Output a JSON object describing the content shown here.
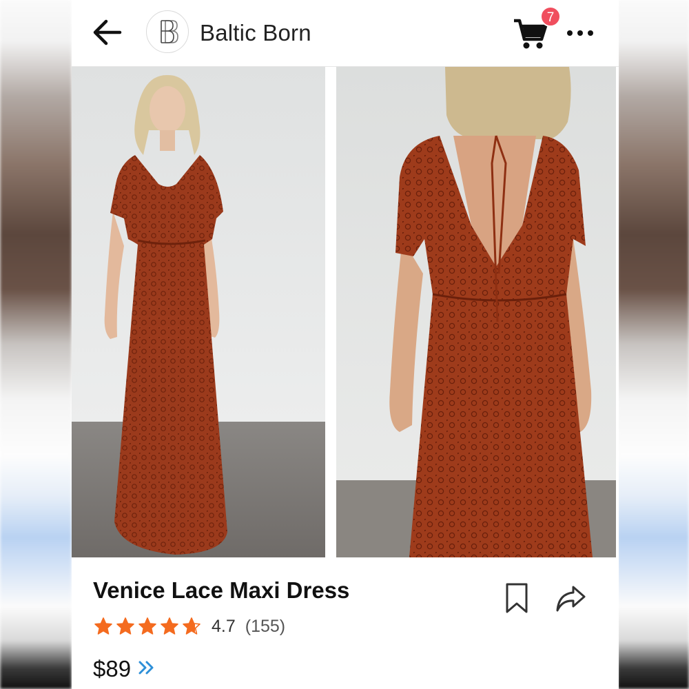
{
  "header": {
    "store_name": "Baltic Born",
    "cart_count": "7"
  },
  "product": {
    "title": "Venice Lace Maxi Dress",
    "rating": "4.7",
    "review_count": "(155)",
    "rating_stars": 4.7,
    "price": "$89"
  },
  "icons": {
    "back": "arrow-left-icon",
    "cart": "shopping-cart-icon",
    "more": "more-horizontal-icon",
    "bookmark": "bookmark-icon",
    "share": "share-icon",
    "price_more": "double-chevron-right-icon"
  },
  "colors": {
    "accent_star": "#f46b1f",
    "badge": "#f04e5e",
    "chevron": "#2d8fd8",
    "dress": "#9b3a1c"
  }
}
